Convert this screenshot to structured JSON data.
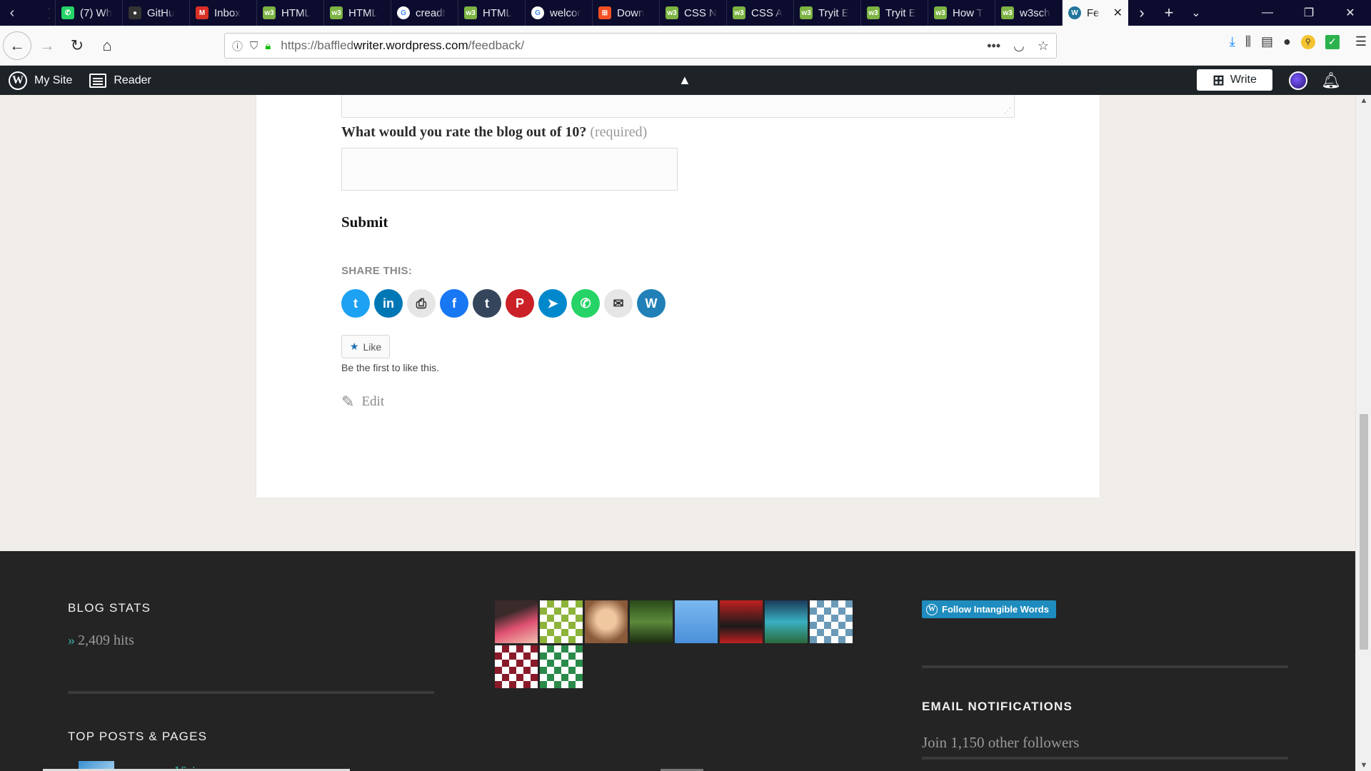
{
  "browser": {
    "tabs": [
      {
        "label": ") ",
        "fav_color": "#0c0c2e",
        "fav_text": "",
        "fav_name": "blank-icon"
      },
      {
        "label": "(7) Wh",
        "fav_color": "#25d366",
        "fav_text": "✆",
        "fav_name": "whatsapp-icon"
      },
      {
        "label": "GitHu",
        "fav_color": "#333333",
        "fav_text": "●",
        "fav_name": "github-icon"
      },
      {
        "label": "Inbox",
        "fav_color": "#d93025",
        "fav_text": "M",
        "fav_name": "gmail-icon"
      },
      {
        "label": "HTML",
        "fav_color": "#7cb342",
        "fav_text": "w3",
        "fav_name": "w3schools-icon"
      },
      {
        "label": "HTML",
        "fav_color": "#7cb342",
        "fav_text": "w3",
        "fav_name": "w3schools-icon"
      },
      {
        "label": "creadt",
        "fav_color": "#ffffff",
        "fav_text": "G",
        "fav_name": "google-icon"
      },
      {
        "label": "HTML",
        "fav_color": "#7cb342",
        "fav_text": "w3",
        "fav_name": "w3schools-icon"
      },
      {
        "label": "welcor",
        "fav_color": "#ffffff",
        "fav_text": "G",
        "fav_name": "google-icon"
      },
      {
        "label": "Down",
        "fav_color": "#f25022",
        "fav_text": "⊞",
        "fav_name": "microsoft-icon"
      },
      {
        "label": "CSS N",
        "fav_color": "#7cb342",
        "fav_text": "w3",
        "fav_name": "w3schools-icon"
      },
      {
        "label": "CSS A",
        "fav_color": "#7cb342",
        "fav_text": "w3",
        "fav_name": "w3schools-icon"
      },
      {
        "label": "Tryit E",
        "fav_color": "#7cb342",
        "fav_text": "w3",
        "fav_name": "w3schools-icon"
      },
      {
        "label": "Tryit E",
        "fav_color": "#7cb342",
        "fav_text": "w3",
        "fav_name": "w3schools-icon"
      },
      {
        "label": "How T",
        "fav_color": "#7cb342",
        "fav_text": "w3",
        "fav_name": "w3schools-icon"
      },
      {
        "label": "w3sch",
        "fav_color": "#7cb342",
        "fav_text": "w3",
        "fav_name": "w3schools-icon"
      }
    ],
    "active_tab": {
      "label": "Fe",
      "fav_color": "#21759b"
    },
    "url_prefix": "https://baffled",
    "url_host": "writer.wordpress.com",
    "url_path": "/feedback/"
  },
  "wpbar": {
    "my_site": "My Site",
    "reader": "Reader",
    "write": "Write"
  },
  "form": {
    "rating_label": "What would you rate the blog out of 10?",
    "required": "(required)",
    "submit": "Submit"
  },
  "share": {
    "title": "SHARE THIS:",
    "buttons": [
      {
        "name": "twitter",
        "color": "#1da1f2",
        "glyph": "t"
      },
      {
        "name": "linkedin",
        "color": "#0077b5",
        "glyph": "in"
      },
      {
        "name": "print",
        "color": "#e6e6e6",
        "glyph": "⎙"
      },
      {
        "name": "facebook",
        "color": "#1877f2",
        "glyph": "f"
      },
      {
        "name": "tumblr",
        "color": "#35465c",
        "glyph": "t"
      },
      {
        "name": "pinterest",
        "color": "#cb2027",
        "glyph": "P"
      },
      {
        "name": "telegram",
        "color": "#0088cc",
        "glyph": "➤"
      },
      {
        "name": "whatsapp",
        "color": "#25d366",
        "glyph": "✆"
      },
      {
        "name": "email",
        "color": "#e6e6e6",
        "glyph": "✉"
      },
      {
        "name": "wordpress",
        "color": "#2180b7",
        "glyph": "W"
      }
    ]
  },
  "like": {
    "label": "Like",
    "note": "Be the first to like this."
  },
  "edit": "Edit",
  "footer": {
    "blog_stats_title": "BLOG STATS",
    "hits": "2,409 hits",
    "top_posts_title": "TOP POSTS & PAGES",
    "vision_peek": "Vision",
    "follow_label": "Follow Intangible Words",
    "email_title": "EMAIL NOTIFICATIONS",
    "join_text": "Join 1,150 other followers",
    "avatars": [
      {
        "bg": "linear-gradient(160deg,#3a2a2a 30%,#e05070 60%,#f0c0b0)"
      },
      {
        "bg": "repeating-conic-gradient(#8db33a 0 25%,#ffffff 0 50%) 0 0/20px 20px"
      },
      {
        "bg": "radial-gradient(circle at 50% 45%,#f0c8a0 30%,#8a5a3a 70%)"
      },
      {
        "bg": "linear-gradient(180deg,#2a4a1a,#5a8a3a 50%,#1a2a10)"
      },
      {
        "bg": "linear-gradient(180deg,#7ab8f0,#4a90d9)"
      },
      {
        "bg": "linear-gradient(180deg,#c02020,#1a1a1a 60%,#c02020)"
      },
      {
        "bg": "linear-gradient(180deg,#1a3a5a,#3ab0c0 50%,#2a6a3a)"
      },
      {
        "bg": "repeating-conic-gradient(#6a9ab8 0 25%,#ffffff 0 50%) 0 0/20px 20px"
      },
      {
        "bg": "repeating-conic-gradient(#8a1a2a 0 25%,#ffffff 0 50%) 0 0/20px 20px"
      },
      {
        "bg": "repeating-conic-gradient(#2a8a4a 0 25%,#ffffff 0 50%) 0 0/20px 20px"
      }
    ]
  }
}
